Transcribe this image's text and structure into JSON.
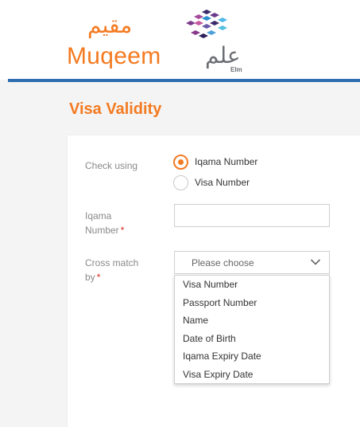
{
  "header": {
    "brand_ar": "مقيم",
    "brand_en": "Muqeem",
    "partner_ar": "علم",
    "partner_en": "Elm"
  },
  "page": {
    "title": "Visa Validity"
  },
  "form": {
    "check_using": {
      "label": "Check using",
      "options": [
        "Iqama Number",
        "Visa Number"
      ],
      "selected": "Iqama Number"
    },
    "iqama_number": {
      "label": "Iqama Number",
      "required_mark": "*",
      "value": ""
    },
    "cross_match": {
      "label": "Cross match by",
      "required_mark": "*",
      "placeholder": "Please choose",
      "options": [
        "Visa Number",
        "Passport Number",
        "Name",
        "Date of Birth",
        "Iqama Expiry Date",
        "Visa Expiry Date"
      ]
    }
  },
  "colors": {
    "accent": "#f47a20",
    "header_line": "#2f6db0",
    "required": "#d9261c",
    "valid": "#4caf50"
  }
}
